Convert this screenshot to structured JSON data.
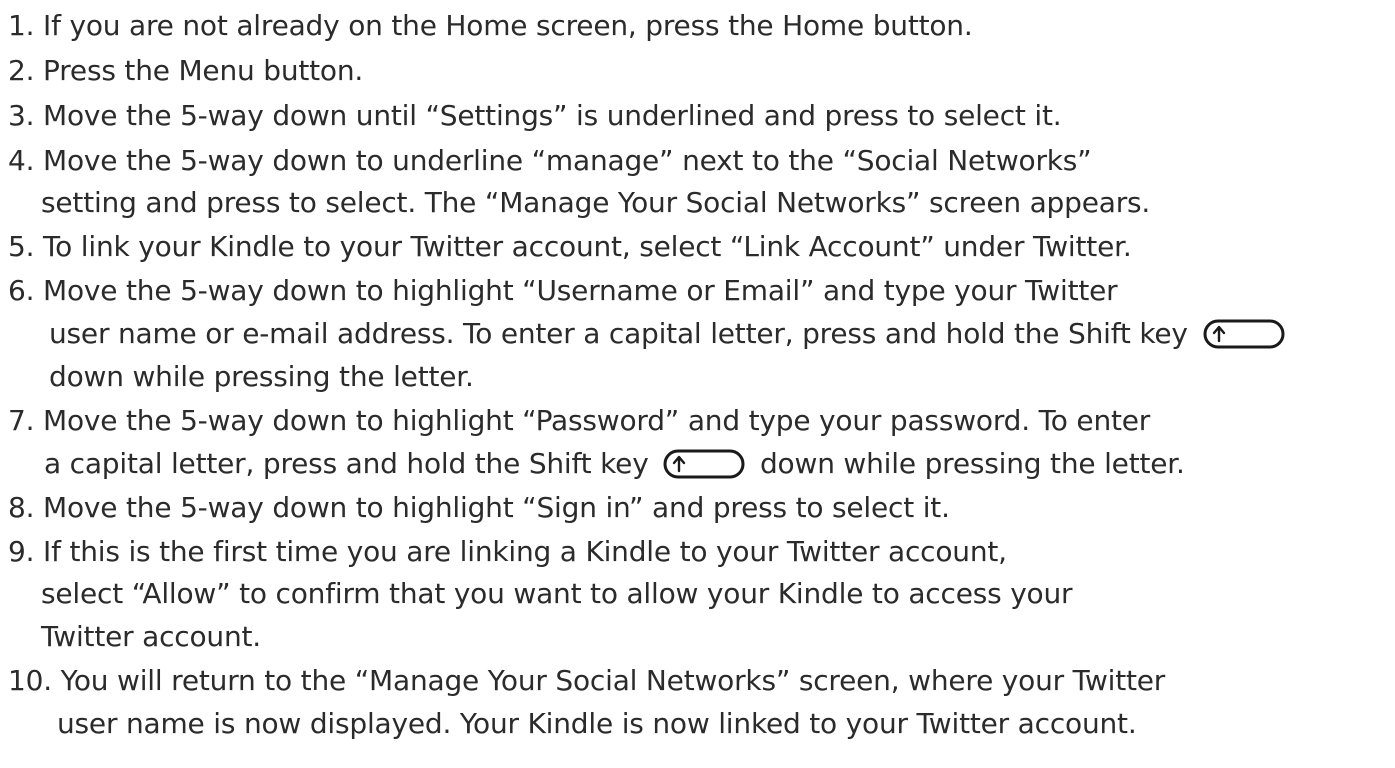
{
  "steps": [
    {
      "number": "1.",
      "lines": [
        "If you are not already on the Home screen, press the Home button."
      ]
    },
    {
      "number": "2.",
      "lines": [
        "Press the Menu button."
      ]
    },
    {
      "number": "3.",
      "lines": [
        "Move the 5-way down until “Settings” is underlined and press to select it."
      ]
    },
    {
      "number": "4.",
      "lines": [
        "Move the 5-way down to underline “manage” next to the “Social Networks”",
        "setting and press to select. The “Manage Your Social Networks” screen appears."
      ]
    },
    {
      "number": "5.",
      "lines": [
        "To link your Kindle to your Twitter account, select “Link Account” under Twitter."
      ]
    },
    {
      "number": "6.",
      "lines": [
        "Move the 5-way down to highlight “Username or Email” and type your Twitter",
        "user name or e-mail address. To enter a capital letter, press and hold the Shift key",
        "down while pressing the letter."
      ]
    },
    {
      "number": "7.",
      "lines": [
        "Move the 5-way down to highlight “Password” and type your password. To enter",
        "a capital letter, press and hold the Shift key",
        "down while pressing the letter."
      ]
    },
    {
      "number": "8.",
      "lines": [
        "Move the 5-way down to highlight “Sign in” and press to select it."
      ]
    },
    {
      "number": "9.",
      "lines": [
        "If this is the first time you are linking a Kindle to your Twitter account,",
        "select “Allow” to confirm that you want to allow your Kindle to access your",
        "Twitter account."
      ]
    },
    {
      "number": "10.",
      "lines": [
        "You will return to the “Manage Your Social Networks” screen, where your Twitter",
        "user name is now displayed. Your Kindle is now linked to your Twitter account."
      ]
    }
  ],
  "icons": {
    "shift_key": "shift-key-icon"
  },
  "colors": {
    "text": "#2b2b2b"
  }
}
